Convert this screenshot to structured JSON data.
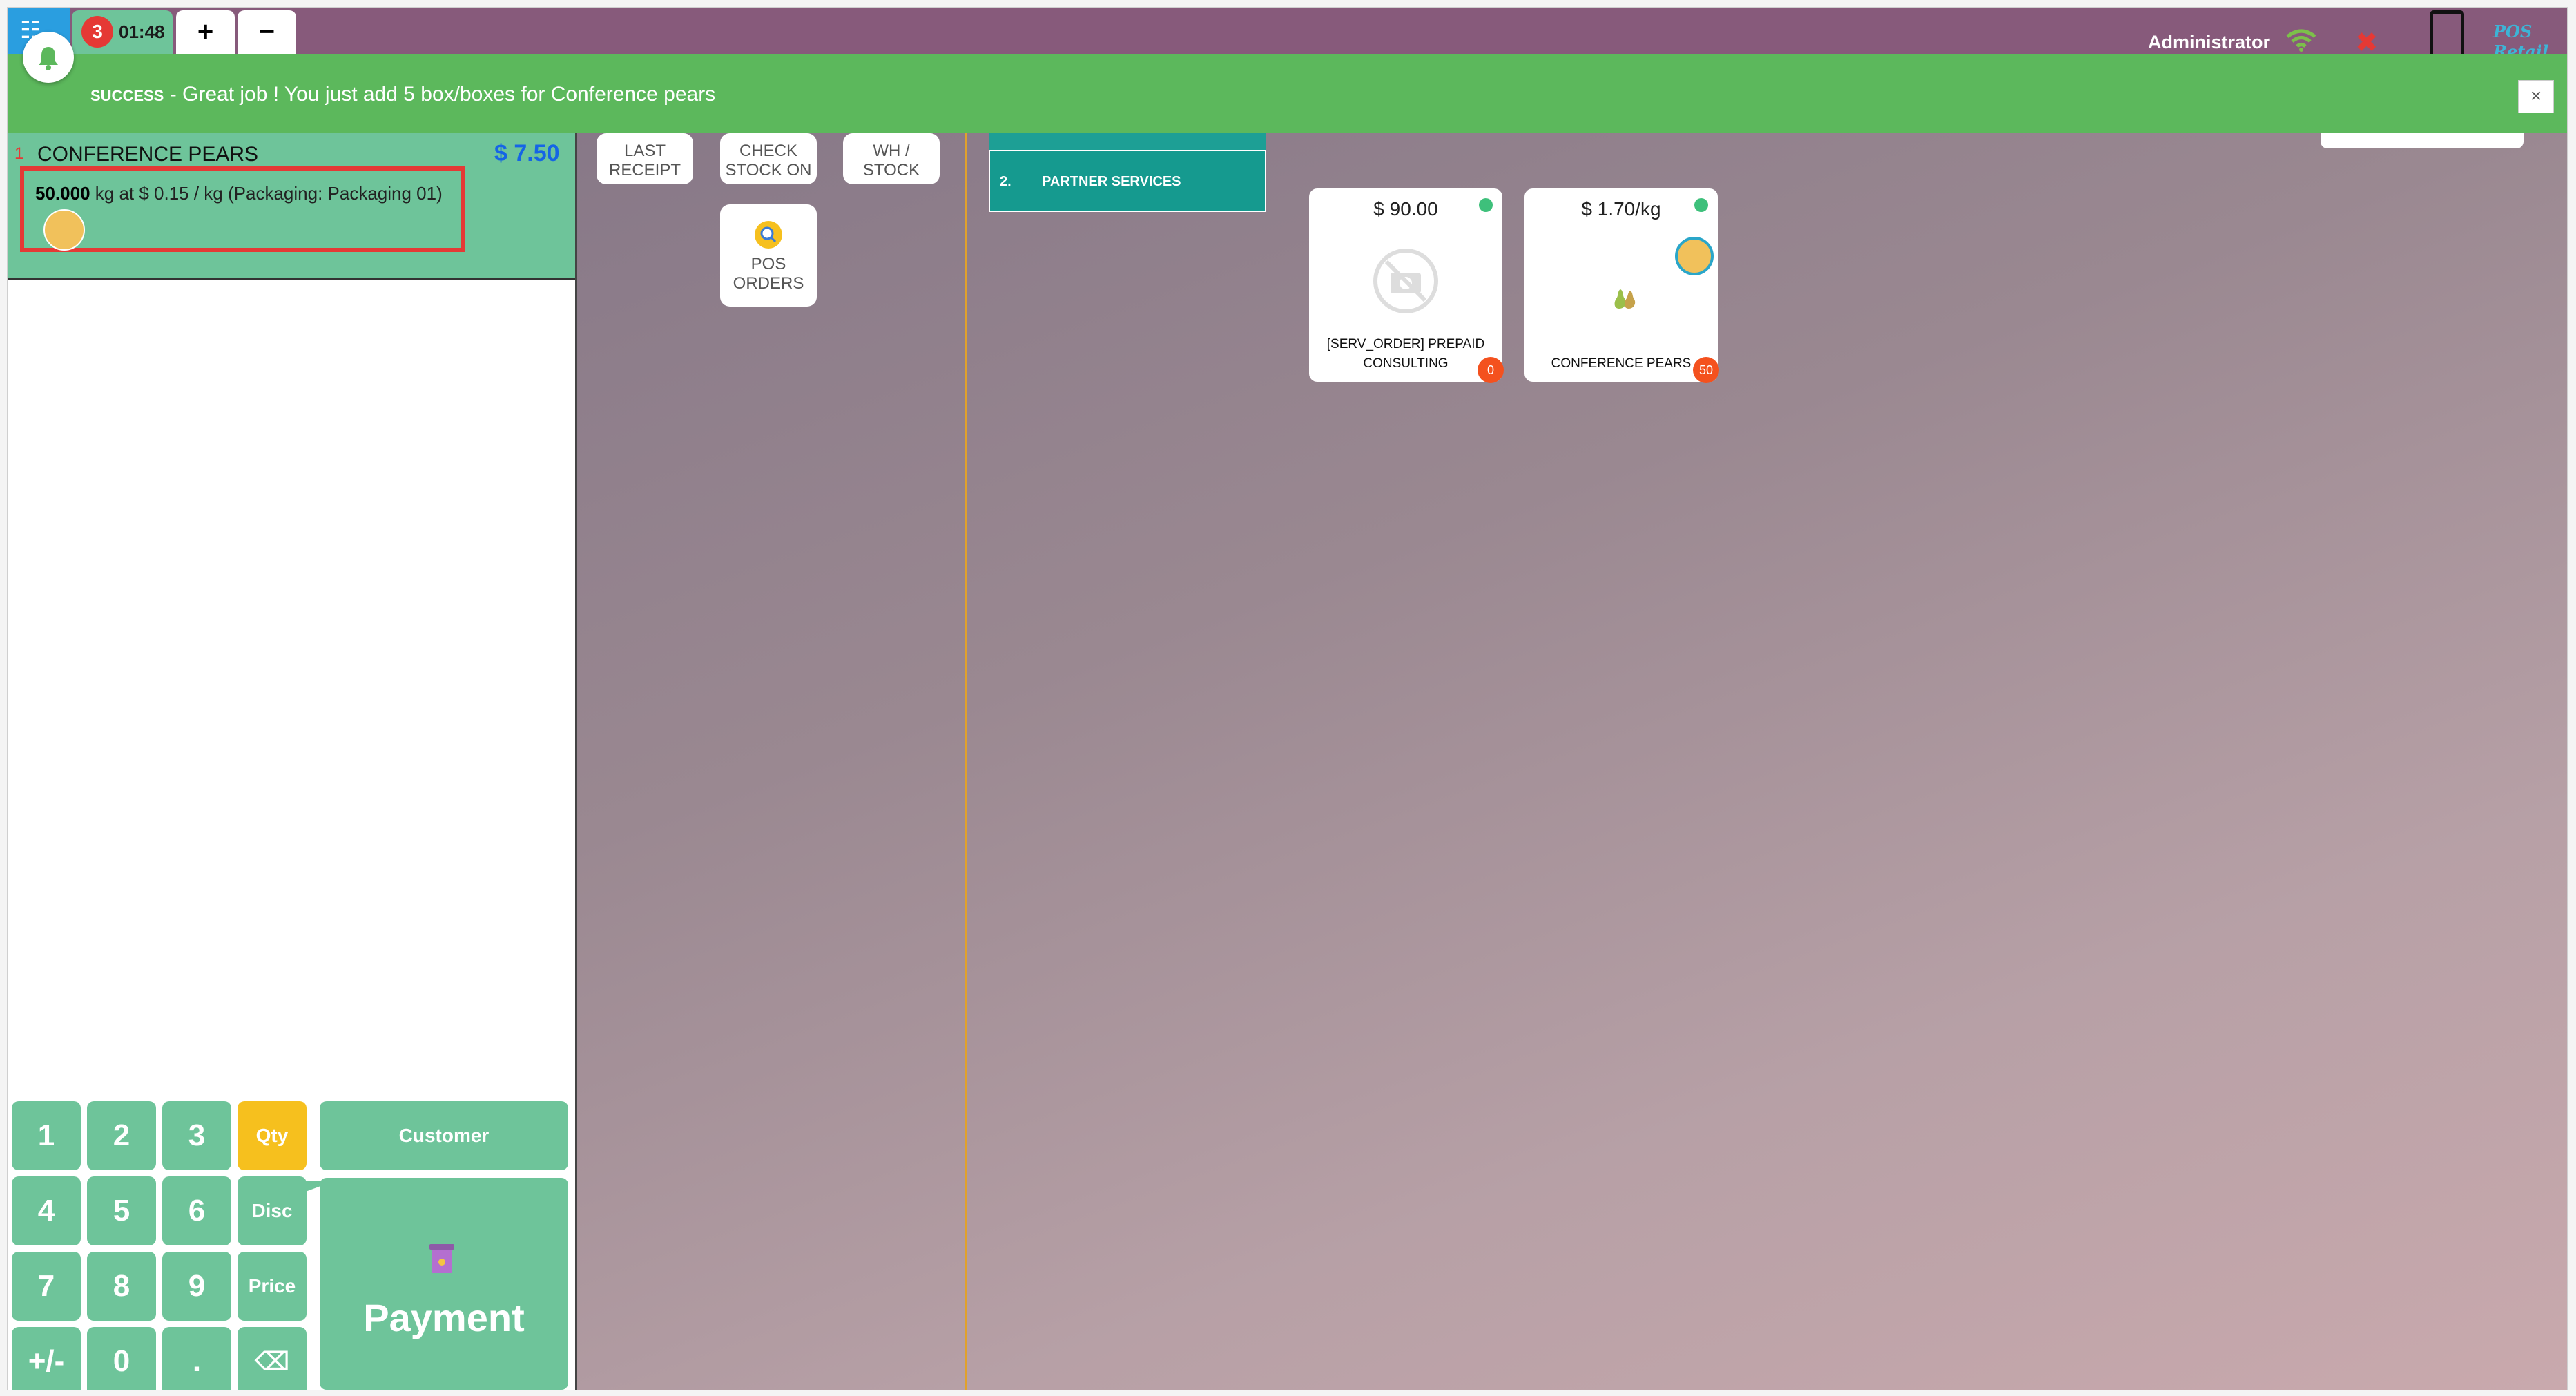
{
  "topbar": {
    "order_count": "3",
    "order_time": "01:48",
    "add_tab": "+",
    "remove_tab": "−",
    "user": "Administrator",
    "logo": "POS Retail"
  },
  "notification": {
    "kind": "SUCCESS",
    "message": " - Great job ! You just add 5 box/boxes for Conference pears",
    "close": "×"
  },
  "orderline": {
    "index": "1",
    "product": "CONFERENCE PEARS",
    "price": "$ 7.50",
    "quantity": "50.000",
    "detail": " kg at $ 0.15 / kg (Packaging: Packaging 01)"
  },
  "numpad": {
    "k1": "1",
    "k2": "2",
    "k3": "3",
    "qty": "Qty",
    "k4": "4",
    "k5": "5",
    "k6": "6",
    "disc": "Disc",
    "k7": "7",
    "k8": "8",
    "k9": "9",
    "price": "Price",
    "sign": "+/-",
    "k0": "0",
    "dot": ".",
    "backspace": "⌫",
    "customer": "Customer",
    "payment": "Payment"
  },
  "tools": {
    "last_receipt": [
      "LAST",
      "RECEIPT"
    ],
    "check_stock": [
      "CHECK",
      "STOCK ON"
    ],
    "wh_stock": "WH / STOCK",
    "pos_orders": [
      "POS",
      "ORDERS"
    ]
  },
  "categories": {
    "partner_num": "2.",
    "partner_label": "PARTNER SERVICES"
  },
  "products": [
    {
      "price": "$ 90.00",
      "name_1": "[SERV_ORDER] PREPAID",
      "name_2": "CONSULTING",
      "qty": "0"
    },
    {
      "price": "$ 1.70/kg",
      "name_1": "CONFERENCE PEARS",
      "qty": "50"
    }
  ],
  "colors": {
    "accent": "#6ec49a",
    "topbar": "#875a7b",
    "success": "#5cb85c",
    "price_blue": "#1565e6",
    "highlight_red": "#e53935"
  }
}
